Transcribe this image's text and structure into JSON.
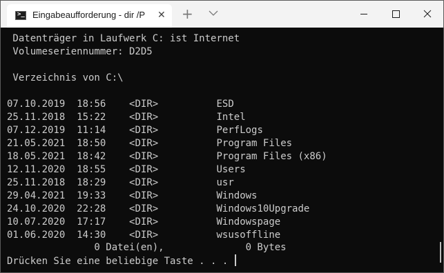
{
  "window": {
    "tab_title": "Eingabeaufforderung - dir  /P"
  },
  "terminal": {
    "header1": " Datenträger in Laufwerk C: ist Internet",
    "header2": " Volumeseriennummer: D2D5",
    "header3": " Verzeichnis von C:\\",
    "rows": [
      {
        "date": "07.10.2019",
        "time": "18:56",
        "type": "<DIR>",
        "name": "ESD"
      },
      {
        "date": "25.11.2018",
        "time": "15:22",
        "type": "<DIR>",
        "name": "Intel"
      },
      {
        "date": "07.12.2019",
        "time": "11:14",
        "type": "<DIR>",
        "name": "PerfLogs"
      },
      {
        "date": "21.05.2021",
        "time": "18:50",
        "type": "<DIR>",
        "name": "Program Files"
      },
      {
        "date": "18.05.2021",
        "time": "18:42",
        "type": "<DIR>",
        "name": "Program Files (x86)"
      },
      {
        "date": "12.11.2020",
        "time": "18:55",
        "type": "<DIR>",
        "name": "Users"
      },
      {
        "date": "25.11.2018",
        "time": "18:29",
        "type": "<DIR>",
        "name": "usr"
      },
      {
        "date": "29.04.2021",
        "time": "19:33",
        "type": "<DIR>",
        "name": "Windows"
      },
      {
        "date": "24.10.2020",
        "time": "22:28",
        "type": "<DIR>",
        "name": "Windows10Upgrade"
      },
      {
        "date": "10.07.2020",
        "time": "17:17",
        "type": "<DIR>",
        "name": "Windowspage"
      },
      {
        "date": "01.06.2020",
        "time": "14:30",
        "type": "<DIR>",
        "name": "wsusoffline"
      }
    ],
    "summary": "               0 Datei(en),              0 Bytes",
    "prompt": "Drücken Sie eine beliebige Taste . . . "
  },
  "icons": {
    "app": "command-prompt-icon",
    "close_tab": "close-icon",
    "new_tab": "plus-icon",
    "dropdown": "chevron-down-icon",
    "minimize": "minimize-icon",
    "maximize": "maximize-icon",
    "close_window": "close-icon"
  },
  "colors": {
    "background": "#0c0c0c",
    "text": "#cccccc",
    "titlebar": "#f3f3f3",
    "tab": "#ffffff"
  }
}
